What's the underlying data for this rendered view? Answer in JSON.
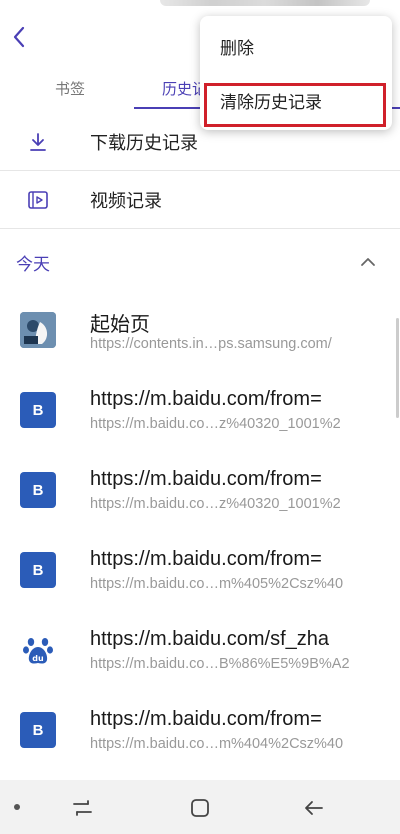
{
  "header": {
    "back_icon": "back-chevron-icon"
  },
  "tabs": [
    {
      "label": "书签"
    },
    {
      "label": "历史记"
    }
  ],
  "quick_links": [
    {
      "label": "下载历史记录",
      "icon": "download-icon"
    },
    {
      "label": "视频记录",
      "icon": "video-icon"
    }
  ],
  "section": {
    "title": "今天",
    "toggle_icon": "chevron-up-icon"
  },
  "history": [
    {
      "title": "起始页",
      "url": "https://contents.in…ps.samsung.com/",
      "favicon": "start-page-favicon",
      "fav_text": ""
    },
    {
      "title": "https://m.baidu.com/from=",
      "url": "https://m.baidu.co…z%40320_1001%2",
      "favicon": "b-favicon",
      "fav_text": "B"
    },
    {
      "title": "https://m.baidu.com/from=",
      "url": "https://m.baidu.co…z%40320_1001%2",
      "favicon": "b-favicon",
      "fav_text": "B"
    },
    {
      "title": "https://m.baidu.com/from=",
      "url": "https://m.baidu.co…m%405%2Csz%40",
      "favicon": "b-favicon",
      "fav_text": "B"
    },
    {
      "title": "https://m.baidu.com/sf_zha",
      "url": "https://m.baidu.co…B%86%E5%9B%A2",
      "favicon": "baidu-paw-favicon",
      "fav_text": "du"
    },
    {
      "title": "https://m.baidu.com/from=",
      "url": "https://m.baidu.co…m%404%2Csz%40",
      "favicon": "b-favicon",
      "fav_text": "B"
    }
  ],
  "menu": {
    "items": [
      {
        "label": "删除"
      },
      {
        "label": "清除历史记录"
      }
    ]
  },
  "colors": {
    "accent": "#4a3fb5",
    "highlight": "#d0202a",
    "favicon_blue": "#2b5cb8"
  }
}
